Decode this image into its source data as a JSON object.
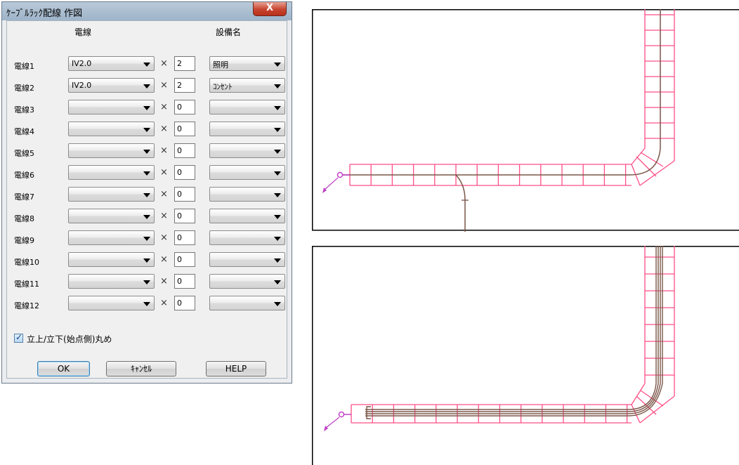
{
  "dialog": {
    "title": "ｹｰﾌﾞﾙﾗｯｸ配線 作図",
    "close_label": "X",
    "col_wire": "電線",
    "col_equip": "設備名",
    "times": "×",
    "rows": [
      {
        "label": "電線1",
        "wire": "IV2.0",
        "count": "2",
        "equip": "照明"
      },
      {
        "label": "電線2",
        "wire": "IV2.0",
        "count": "2",
        "equip": "ｺﾝｾﾝﾄ"
      },
      {
        "label": "電線3",
        "wire": "",
        "count": "0",
        "equip": ""
      },
      {
        "label": "電線4",
        "wire": "",
        "count": "0",
        "equip": ""
      },
      {
        "label": "電線5",
        "wire": "",
        "count": "0",
        "equip": ""
      },
      {
        "label": "電線6",
        "wire": "",
        "count": "0",
        "equip": ""
      },
      {
        "label": "電線7",
        "wire": "",
        "count": "0",
        "equip": ""
      },
      {
        "label": "電線8",
        "wire": "",
        "count": "0",
        "equip": ""
      },
      {
        "label": "電線9",
        "wire": "",
        "count": "0",
        "equip": ""
      },
      {
        "label": "電線10",
        "wire": "",
        "count": "0",
        "equip": ""
      },
      {
        "label": "電線11",
        "wire": "",
        "count": "0",
        "equip": ""
      },
      {
        "label": "電線12",
        "wire": "",
        "count": "0",
        "equip": ""
      }
    ],
    "checkbox_label": "立上/立下(始点側)丸め",
    "checkbox_checked": true,
    "ok_label": "OK",
    "cancel_label": "ｷｬﾝｾﾙ",
    "help_label": "HELP"
  },
  "colors": {
    "rack": "#ff4f86",
    "wire": "#7a5548",
    "marker": "#c040c8",
    "title_bar": "#a9bdd1",
    "close_button": "#c7442f"
  }
}
